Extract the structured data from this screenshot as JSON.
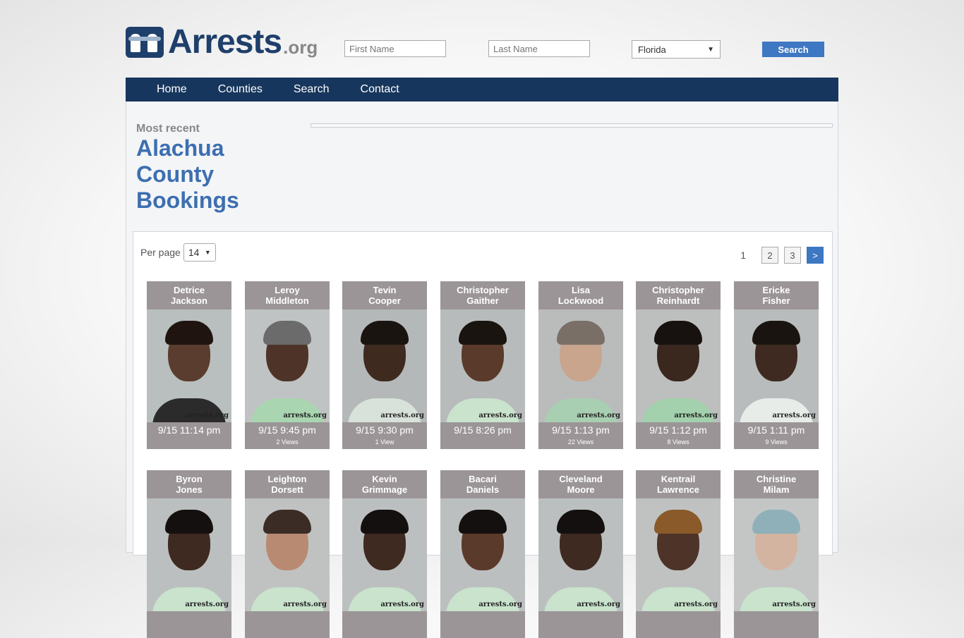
{
  "site": {
    "logo_text": "Arrests",
    "logo_tld": ".org"
  },
  "search": {
    "first_placeholder": "First Name",
    "last_placeholder": "Last Name",
    "state": "Florida",
    "button": "Search"
  },
  "nav": [
    {
      "label": "Home"
    },
    {
      "label": "Counties"
    },
    {
      "label": "Search"
    },
    {
      "label": "Contact"
    }
  ],
  "heading": {
    "kicker": "Most recent",
    "title": "Alachua County Bookings"
  },
  "listing": {
    "per_page_label": "Per page",
    "per_page_value": "14",
    "pages": [
      "1",
      "2",
      "3"
    ],
    "current_page": "1",
    "next_label": ">"
  },
  "watermark": "arrests.org",
  "bookings": [
    {
      "first": "Detrice",
      "last": "Jackson",
      "time": "9/15 11:14 pm",
      "views": "",
      "bg": "#b9bfbf",
      "skin": "#5a3d2e",
      "hair": "#1f1410",
      "shirt": "#2b2b2b"
    },
    {
      "first": "Leroy",
      "last": "Middleton",
      "time": "9/15 9:45 pm",
      "views": "2 Views",
      "bg": "#bfc3c3",
      "skin": "#4e3428",
      "hair": "#6b6b6b",
      "shirt": "#a9d5b0"
    },
    {
      "first": "Tevin",
      "last": "Cooper",
      "time": "9/15 9:30 pm",
      "views": "1 View",
      "bg": "#b5b8b8",
      "skin": "#3f2a20",
      "hair": "#1a1410",
      "shirt": "#d8e2da"
    },
    {
      "first": "Christopher",
      "last": "Gaither",
      "time": "9/15 8:26 pm",
      "views": "",
      "bg": "#b7bbbb",
      "skin": "#5a3a2a",
      "hair": "#1a1410",
      "shirt": "#c9e3cd"
    },
    {
      "first": "Lisa",
      "last": "Lockwood",
      "time": "9/15 1:13 pm",
      "views": "22 Views",
      "bg": "#b9bcbb",
      "skin": "#c9a58e",
      "hair": "#7a6f66",
      "shirt": "#a8cfb1"
    },
    {
      "first": "Christopher",
      "last": "Reinhardt",
      "time": "9/15 1:12 pm",
      "views": "8 Views",
      "bg": "#bdbfbe",
      "skin": "#3a271e",
      "hair": "#171110",
      "shirt": "#a3d0ad"
    },
    {
      "first": "Ericke",
      "last": "Fisher",
      "time": "9/15 1:11 pm",
      "views": "9 Views",
      "bg": "#b9bcbc",
      "skin": "#3e2a20",
      "hair": "#1a1410",
      "shirt": "#e8ece8"
    },
    {
      "first": "Byron",
      "last": "Jones",
      "time": "",
      "views": "",
      "bg": "#bcbfbf",
      "skin": "#3e2a20",
      "hair": "#151010",
      "shirt": "#c9e3cd"
    },
    {
      "first": "Leighton",
      "last": "Dorsett",
      "time": "",
      "views": "",
      "bg": "#c0c2c1",
      "skin": "#b98a72",
      "hair": "#3b2c25",
      "shirt": "#c9e3cd"
    },
    {
      "first": "Kevin",
      "last": "Grimmage",
      "time": "",
      "views": "",
      "bg": "#bcbfbf",
      "skin": "#3e2a20",
      "hair": "#151010",
      "shirt": "#c9e3cd"
    },
    {
      "first": "Bacari",
      "last": "Daniels",
      "time": "",
      "views": "",
      "bg": "#bcbfbf",
      "skin": "#5a3a2a",
      "hair": "#151010",
      "shirt": "#c9e3cd"
    },
    {
      "first": "Cleveland",
      "last": "Moore",
      "time": "",
      "views": "",
      "bg": "#bcbfbf",
      "skin": "#3e2a20",
      "hair": "#151010",
      "shirt": "#c9e3cd"
    },
    {
      "first": "Kentrail",
      "last": "Lawrence",
      "time": "",
      "views": "",
      "bg": "#c0c2c1",
      "skin": "#4e3428",
      "hair": "#8a5a2a",
      "shirt": "#c9e3cd"
    },
    {
      "first": "Christine",
      "last": "Milam",
      "time": "",
      "views": "",
      "bg": "#c4c6c5",
      "skin": "#d2b4a0",
      "hair": "#8fb0b8",
      "shirt": "#c9e3cd"
    }
  ]
}
